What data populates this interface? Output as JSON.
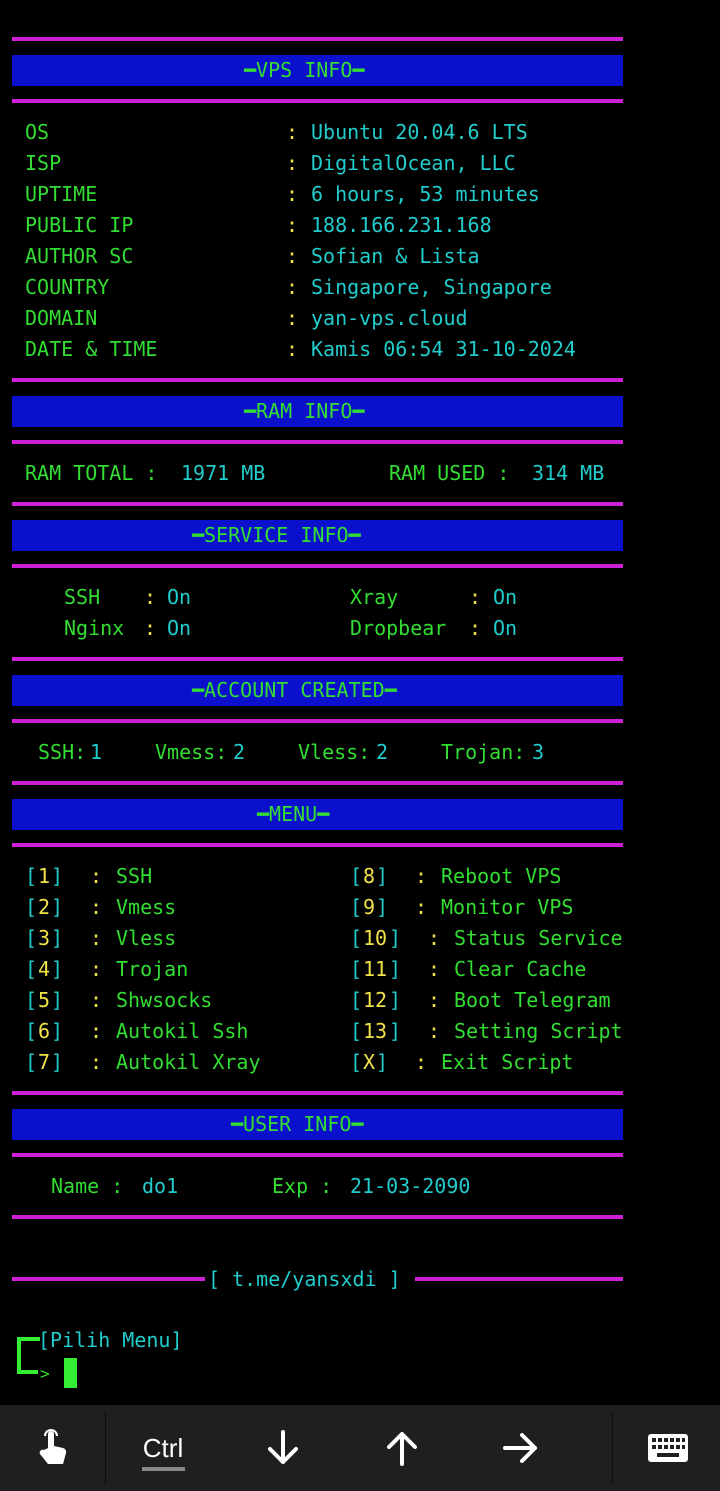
{
  "sections": {
    "vps": "━VPS INFO━",
    "ram": "━RAM INFO━",
    "service": "━SERVICE INFO━",
    "account": "━ACCOUNT CREATED━",
    "menu": "━MENU━",
    "user": "━USER INFO━"
  },
  "vps_info": [
    {
      "key": "OS",
      "value": "Ubuntu 20.04.6 LTS"
    },
    {
      "key": "ISP",
      "value": "DigitalOcean, LLC"
    },
    {
      "key": "UPTIME",
      "value": "6 hours, 53 minutes"
    },
    {
      "key": "PUBLIC IP",
      "value": "188.166.231.168"
    },
    {
      "key": "AUTHOR SC",
      "value": "Sofian & Lista"
    },
    {
      "key": "COUNTRY",
      "value": "Singapore, Singapore"
    },
    {
      "key": "DOMAIN",
      "value": "yan-vps.cloud"
    },
    {
      "key": "DATE & TIME",
      "value": "Kamis 06:54 31-10-2024"
    }
  ],
  "ram": {
    "total_label": "RAM TOTAL :",
    "total_value": "1971 MB",
    "used_label": "RAM USED :",
    "used_value": "314 MB"
  },
  "services": [
    {
      "name": "SSH",
      "status": "On"
    },
    {
      "name": "Nginx",
      "status": "On"
    },
    {
      "name": "Xray",
      "status": "On"
    },
    {
      "name": "Dropbear",
      "status": "On"
    }
  ],
  "accounts": [
    {
      "label": "SSH:",
      "count": "1"
    },
    {
      "label": "Vmess:",
      "count": "2"
    },
    {
      "label": "Vless:",
      "count": "2"
    },
    {
      "label": "Trojan:",
      "count": "3"
    }
  ],
  "menu_left": [
    {
      "key": "1",
      "label": "SSH"
    },
    {
      "key": "2",
      "label": "Vmess"
    },
    {
      "key": "3",
      "label": "Vless"
    },
    {
      "key": "4",
      "label": "Trojan"
    },
    {
      "key": "5",
      "label": "Shwsocks"
    },
    {
      "key": "6",
      "label": "Autokil Ssh"
    },
    {
      "key": "7",
      "label": "Autokil Xray"
    }
  ],
  "menu_right": [
    {
      "key": "8",
      "label": "Reboot VPS"
    },
    {
      "key": "9",
      "label": "Monitor VPS"
    },
    {
      "key": "10",
      "label": "Status Service"
    },
    {
      "key": "11",
      "label": "Clear Cache"
    },
    {
      "key": "12",
      "label": "Boot Telegram"
    },
    {
      "key": "13",
      "label": "Setting Script"
    },
    {
      "key": "X",
      "label": "Exit Script"
    }
  ],
  "user": {
    "name_label": "Name :",
    "name_value": "do1",
    "exp_label": "Exp :",
    "exp_value": "21-03-2090"
  },
  "footer_link": "[ t.me/yansxdi ]",
  "prompt": {
    "bracket": "[Pilih Menu]",
    "arrow": ">"
  },
  "toolbar": {
    "ctrl": "Ctrl",
    "icons": [
      "touch-hand-icon",
      "arrow-down-icon",
      "arrow-up-icon",
      "arrow-right-icon",
      "keyboard-icon"
    ]
  },
  "colors": {
    "background": "#000000",
    "text_green": "#33dd33",
    "text_cyan": "#22cccc",
    "text_yellow": "#f2e24a",
    "rule_magenta": "#cc1fd6",
    "band_blue": "#0a10cc"
  }
}
